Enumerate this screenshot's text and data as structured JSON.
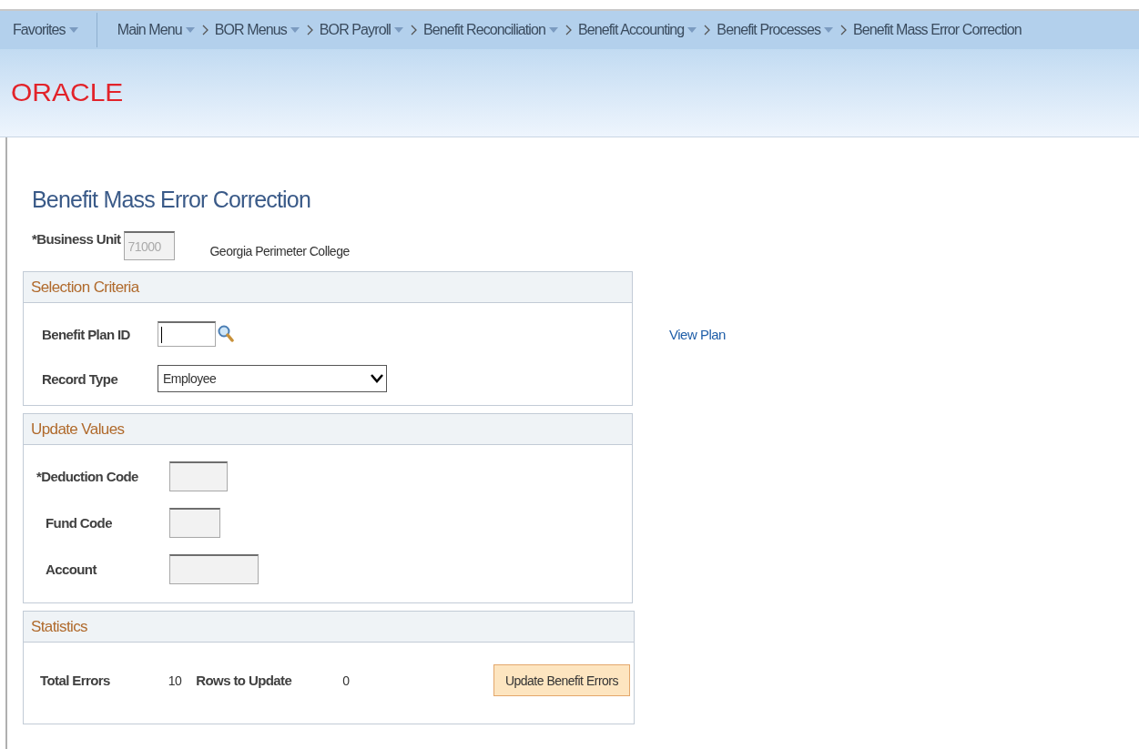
{
  "nav": {
    "favorites": {
      "label": "Favorites",
      "dropdown": true
    },
    "breadcrumbs": [
      {
        "label": "Main Menu",
        "dropdown": true
      },
      {
        "label": "BOR Menus",
        "dropdown": true
      },
      {
        "label": "BOR Payroll",
        "dropdown": true
      },
      {
        "label": "Benefit Reconciliation",
        "dropdown": true
      },
      {
        "label": "Benefit Accounting",
        "dropdown": true
      },
      {
        "label": "Benefit Processes",
        "dropdown": true
      },
      {
        "label": "Benefit Mass Error Correction",
        "dropdown": false
      }
    ]
  },
  "logo": "ORACLE",
  "page_title": "Benefit Mass Error Correction",
  "business_unit": {
    "label": "*Business Unit",
    "value": "71000",
    "disabled": true,
    "description": "Georgia Perimeter College"
  },
  "selection_criteria": {
    "title": "Selection Criteria",
    "benefit_plan_id": {
      "label": "Benefit Plan ID"
    },
    "view_plan_link": "View Plan",
    "record_type": {
      "label": "Record Type",
      "value": "Employee"
    }
  },
  "update_values": {
    "title": "Update Values",
    "fields": [
      {
        "label": "*Deduction Code",
        "disabled": true
      },
      {
        "label": "Fund Code",
        "disabled": true
      },
      {
        "label": "Account",
        "disabled": true
      }
    ]
  },
  "statistics": {
    "title": "Statistics",
    "total_errors_label": "Total Errors",
    "total_errors": "10",
    "rows_to_update_label": "Rows to Update",
    "rows_to_update": "0",
    "button": "Update Benefit Errors"
  }
}
